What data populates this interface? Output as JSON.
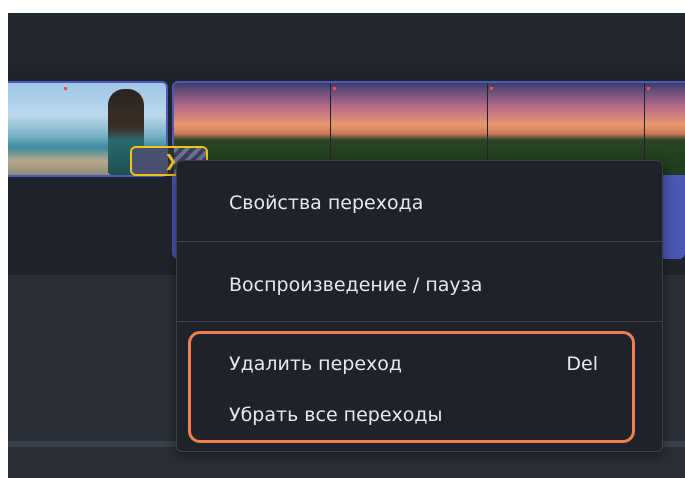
{
  "context_menu": {
    "items": [
      {
        "label": "Свойства перехода",
        "shortcut": ""
      },
      {
        "label": "Воспроизведение / пауза",
        "shortcut": ""
      },
      {
        "label": "Удалить переход",
        "shortcut": "Del"
      },
      {
        "label": "Убрать все переходы",
        "shortcut": ""
      }
    ]
  },
  "colors": {
    "clip_border": "#4d5bb8",
    "transition_highlight": "#f0c419",
    "annotation_highlight": "#f07f4b",
    "menu_background": "#1e232b"
  },
  "icons": {
    "transition": "transition-chevron-icon"
  }
}
